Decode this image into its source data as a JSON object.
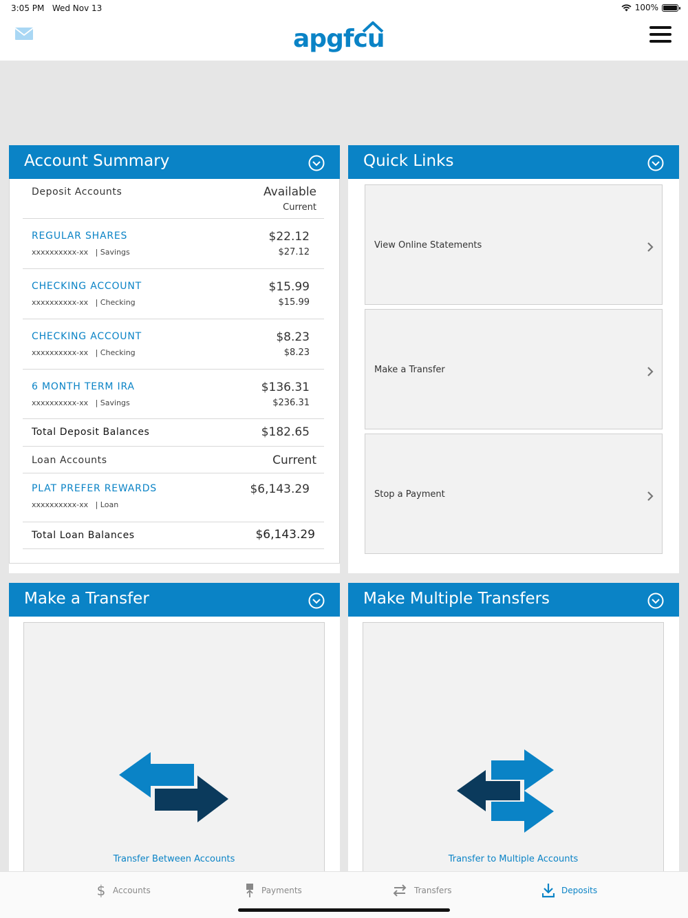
{
  "status": {
    "time": "3:05 PM",
    "date": "Wed Nov 13",
    "battery": "100%",
    "battery_level": 1.0
  },
  "header": {
    "logo": "apgfcu",
    "mail_icon": "mail-icon",
    "menu_icon": "hamburger-menu-icon"
  },
  "colors": {
    "brand": "#0a83c6",
    "dark_arrow": "#0b3a5c",
    "background": "#e6e6e6"
  },
  "account_summary": {
    "title": "Account Summary",
    "deposit_header": "Deposit Accounts",
    "available_label": "Available",
    "current_label": "Current",
    "deposits": [
      {
        "name": "REGULAR SHARES",
        "number": "xxxxxxxxxx-xx",
        "type": "| Savings",
        "available": "$22.12",
        "current": "$27.12"
      },
      {
        "name": "CHECKING ACCOUNT",
        "number": "xxxxxxxxxx-xx",
        "type": "| Checking",
        "available": "$15.99",
        "current": "$15.99"
      },
      {
        "name": "CHECKING ACCOUNT",
        "number": "xxxxxxxxxx-xx",
        "type": "| Checking",
        "available": "$8.23",
        "current": "$8.23"
      },
      {
        "name": "6 MONTH TERM IRA",
        "number": "xxxxxxxxxx-xx",
        "type": "| Savings",
        "available": "$136.31",
        "current": "$236.31"
      }
    ],
    "total_deposit_label": "Total Deposit Balances",
    "total_deposit_value": "$182.65",
    "loan_header": "Loan Accounts",
    "loan_current_label": "Current",
    "loans": [
      {
        "name": "PLAT PREFER REWARDS",
        "number": "xxxxxxxxxx-xx",
        "type": "| Loan",
        "current": "$6,143.29"
      }
    ],
    "total_loan_label": "Total Loan Balances",
    "total_loan_value": "$6,143.29"
  },
  "quick_links": {
    "title": "Quick Links",
    "items": [
      {
        "label": "View Online Statements"
      },
      {
        "label": "Make a Transfer"
      },
      {
        "label": "Stop a Payment"
      }
    ]
  },
  "make_transfer": {
    "title": "Make a Transfer",
    "card_label": "Transfer Between Accounts"
  },
  "multi_transfer": {
    "title": "Make Multiple Transfers",
    "card_label": "Transfer to Multiple Accounts"
  },
  "tabbar": {
    "tabs": [
      {
        "label": "Accounts",
        "icon": "dollar-icon"
      },
      {
        "label": "Payments",
        "icon": "payment-icon"
      },
      {
        "label": "Transfers",
        "icon": "transfer-icon"
      },
      {
        "label": "Deposits",
        "icon": "download-icon",
        "active": true
      }
    ]
  }
}
